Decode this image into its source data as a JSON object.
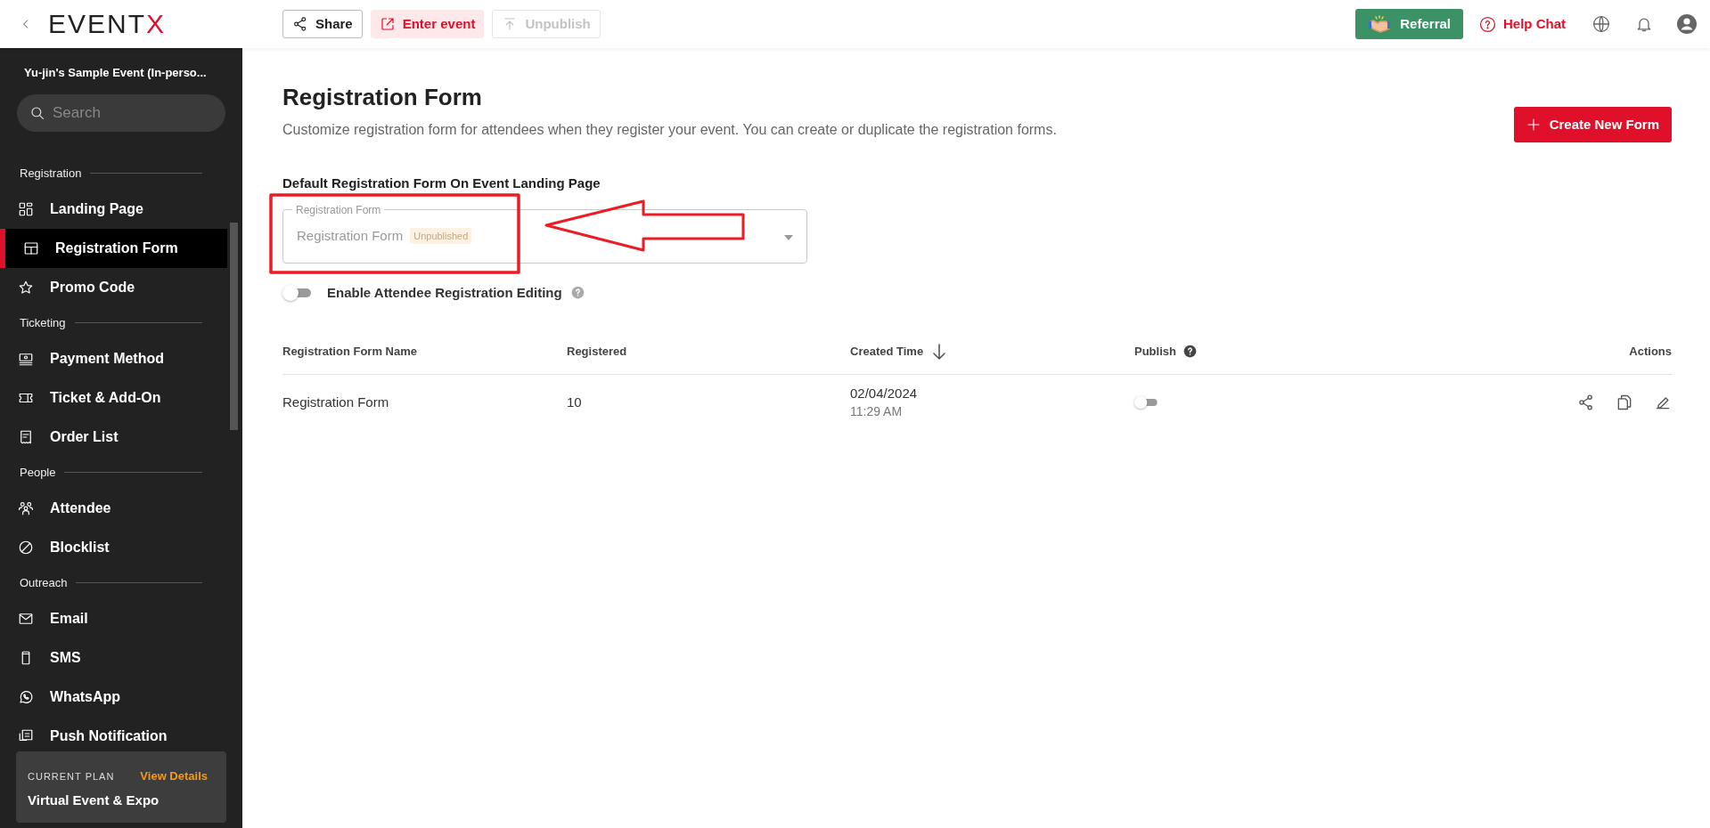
{
  "header": {
    "logo": {
      "text": "EVENT",
      "accent": "X"
    },
    "buttons": [
      {
        "label": "Share",
        "kind": "outline",
        "disabled": false
      },
      {
        "label": "Enter event",
        "kind": "accent",
        "disabled": false
      },
      {
        "label": "Unpublish",
        "kind": "outline",
        "disabled": true
      }
    ],
    "referral": "Referral",
    "help": "Help Chat"
  },
  "sidebar": {
    "event_name": "Yu-jin's Sample Event (In-perso...",
    "search": {
      "placeholder": "Search"
    },
    "sections": [
      {
        "label": "Registration",
        "items": [
          {
            "label": "Landing Page",
            "selected": false
          },
          {
            "label": "Registration Form",
            "selected": true
          },
          {
            "label": "Promo Code",
            "selected": false
          }
        ]
      },
      {
        "label": "Ticketing",
        "items": [
          {
            "label": "Payment Method",
            "selected": false
          },
          {
            "label": "Ticket & Add-On",
            "selected": false
          },
          {
            "label": "Order List",
            "selected": false
          }
        ]
      },
      {
        "label": "People",
        "items": [
          {
            "label": "Attendee",
            "selected": false
          },
          {
            "label": "Blocklist",
            "selected": false
          }
        ]
      },
      {
        "label": "Outreach",
        "items": [
          {
            "label": "Email",
            "selected": false
          },
          {
            "label": "SMS",
            "selected": false
          },
          {
            "label": "WhatsApp",
            "selected": false
          },
          {
            "label": "Push Notification",
            "selected": false
          }
        ]
      }
    ],
    "plan": {
      "caption": "CURRENT PLAN",
      "link": "View Details",
      "name": "Virtual Event & Expo"
    }
  },
  "main": {
    "title": "Registration Form",
    "description": "Customize registration form for attendees when they register your event. You can create or duplicate the registration forms.",
    "create_button": "Create New Form",
    "default_form": {
      "heading": "Default Registration Form On Event Landing Page",
      "field_label": "Registration Form",
      "value": "Registration Form",
      "badge": "Unpublished"
    },
    "editing_toggle": {
      "label": "Enable Attendee Registration Editing",
      "on": false
    },
    "table": {
      "columns": [
        "Registration Form Name",
        "Registered",
        "Created Time",
        "Publish",
        "Actions"
      ],
      "rows": [
        {
          "name": "Registration Form",
          "registered": "10",
          "date": "02/04/2024",
          "time": "11:29 AM",
          "publish": false
        }
      ]
    }
  }
}
